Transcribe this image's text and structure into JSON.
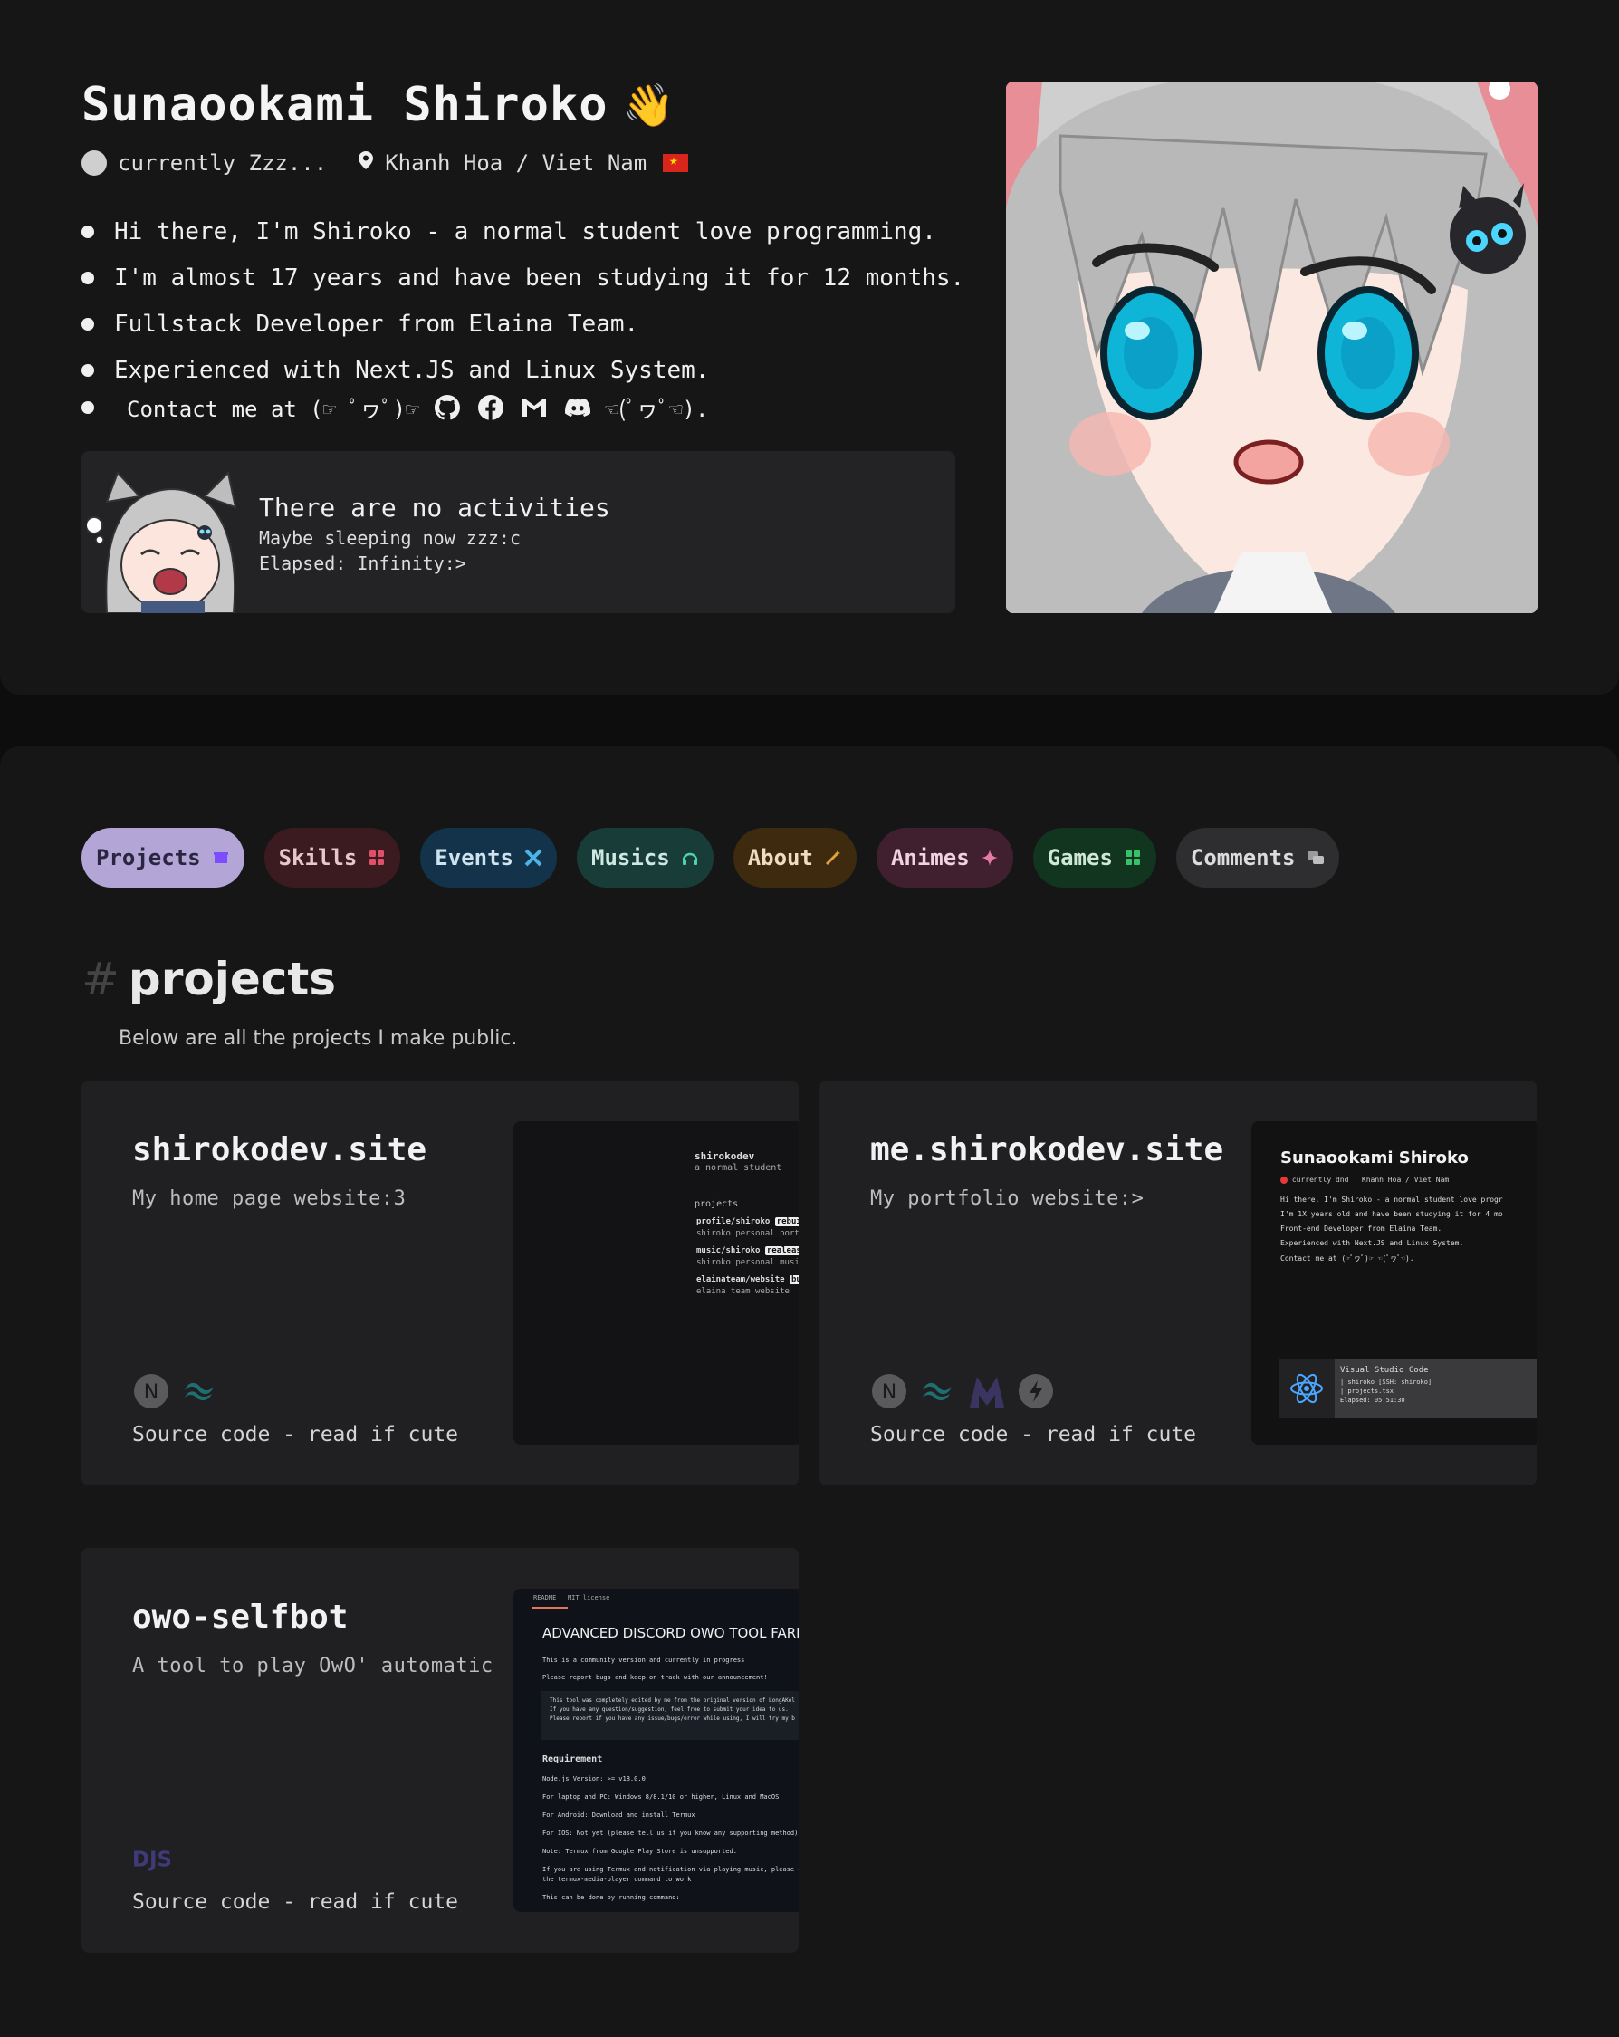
{
  "profile": {
    "name": "Sunaookami Shiroko",
    "wave_emoji": "👋",
    "status": "currently Zzz...",
    "location": "Khanh Hoa / Viet Nam",
    "bio": [
      "Hi there, I'm Shiroko - a normal student love programming.",
      "I'm almost 17 years and have been studying it for 12 months.",
      "Fullstack Developer from Elaina Team.",
      "Experienced with Next.JS and Linux System."
    ],
    "contact_prefix": "Contact me at (☞ ﾟヮﾟ)☞",
    "contact_suffix": "☜(ﾟヮﾟ☜).",
    "contact_icons": [
      "github-icon",
      "facebook-icon",
      "gmail-icon",
      "discord-icon"
    ],
    "activity": {
      "title": "There are no activities",
      "subtitle": "Maybe sleeping now zzz:c",
      "elapsed": "Elapsed: Infinity:>"
    }
  },
  "tabs": [
    {
      "label": "Projects",
      "icon": "box-icon",
      "bg": "#b3a5d6",
      "fg": "#2a2540",
      "ic": "#7c4dff"
    },
    {
      "label": "Skills",
      "icon": "grid-icon",
      "bg": "#3b1a20",
      "fg": "#e5c7cc",
      "ic": "#e0506a"
    },
    {
      "label": "Events",
      "icon": "ribbon-icon",
      "bg": "#12334a",
      "fg": "#cfe3ef",
      "ic": "#4cb3e6"
    },
    {
      "label": "Musics",
      "icon": "headphones-icon",
      "bg": "#183d39",
      "fg": "#cfe8e2",
      "ic": "#4fd1b4"
    },
    {
      "label": "About",
      "icon": "wand-icon",
      "bg": "#3e2a0e",
      "fg": "#f0dcc0",
      "ic": "#e6a03c"
    },
    {
      "label": "Animes",
      "icon": "sparkle-icon",
      "bg": "#40202f",
      "fg": "#efd3de",
      "ic": "#e47ca7"
    },
    {
      "label": "Games",
      "icon": "apps-icon",
      "bg": "#12351f",
      "fg": "#cfe8d6",
      "ic": "#38c06a"
    },
    {
      "label": "Comments",
      "icon": "chat-icon",
      "bg": "#2e2e31",
      "fg": "#dcdcdc",
      "ic": "#9a9a9a"
    }
  ],
  "section": {
    "hash": "#",
    "title": "projects",
    "subtitle": "Below are all the projects I make public."
  },
  "projects": [
    {
      "title": "shirokodev.site",
      "description": "My home page website:3",
      "link": "Source code - read if cute",
      "tech_icons": [
        "nextjs-icon",
        "tailwind-icon"
      ],
      "screenshot": {
        "name": "shirokodev",
        "tagline": "a normal student",
        "heading": "projects",
        "items": [
          {
            "repo": "profile/shiroko",
            "badge": "rebuilding",
            "desc": "shiroko personal portfolio"
          },
          {
            "repo": "music/shiroko",
            "badge": "realeased",
            "desc": "shiroko personal music p"
          },
          {
            "repo": "elainateam/website",
            "badge": "build",
            "desc": "elaina team website"
          }
        ]
      }
    },
    {
      "title": "me.shirokodev.site",
      "description": "My portfolio website:>",
      "link": "Source code - read if cute",
      "tech_icons": [
        "nextjs-icon",
        "tailwind-icon",
        "million-icon",
        "bolt-icon"
      ],
      "screenshot": {
        "name": "Sunaookami Shiroko",
        "status": "currently dnd",
        "location": "Khanh Hoa / Viet Nam",
        "bullets": [
          "Hi there, I'm Shiroko - a normal student love progr",
          "I'm 1X years old and have been studying it for 4 mo",
          "Front-end Developer from Elaina Team.",
          "Experienced with Next.JS and Linux System.",
          "Contact me at (☞ﾟヮﾟ)☞ ☜(ﾟヮﾟ☜)."
        ],
        "presence_app": "Visual Studio Code",
        "presence_line1": "| shiroko [SSH: shiroko]",
        "presence_line2": "| projects.tsx",
        "presence_elapsed": "Elapsed: 05:51:30"
      }
    },
    {
      "title": "owo-selfbot",
      "description": "A tool to play OwO' automatic",
      "link": "Source code - read if cute",
      "tech_icons": [
        "discordjs-icon"
      ],
      "screenshot": {
        "tab1": "README",
        "tab2": "MIT license",
        "heading": "ADVANCED DISCORD OWO TOOL FARM",
        "p1": "This is a community version and currently in progress",
        "p2": "Please report bugs and keep on track with our announcement!",
        "code1": "This tool was completely edited by me from the original version of LongAKol",
        "code2": "If you have any question/suggestion, feel free to submit your idea to us.",
        "code3": "Please report if you have any issue/bugs/error while using, I will try my b",
        "req": "Requirement",
        "r1": "Node.js Version: >= v18.0.0",
        "r2": "For laptop and PC: Windows 8/8.1/10 or higher, Linux and MacOS",
        "r3": "For Android: Download and install Termux",
        "r4": "For IOS: Not yet (please tell us if you know any supporting method)",
        "r5": "Note: Termux from Google Play Store is unsupported.",
        "r6": "If you are using Termux and notification via playing music, please download termu",
        "r7": "the termux-media-player command to work",
        "r8": "This can be done by running command:"
      }
    }
  ]
}
